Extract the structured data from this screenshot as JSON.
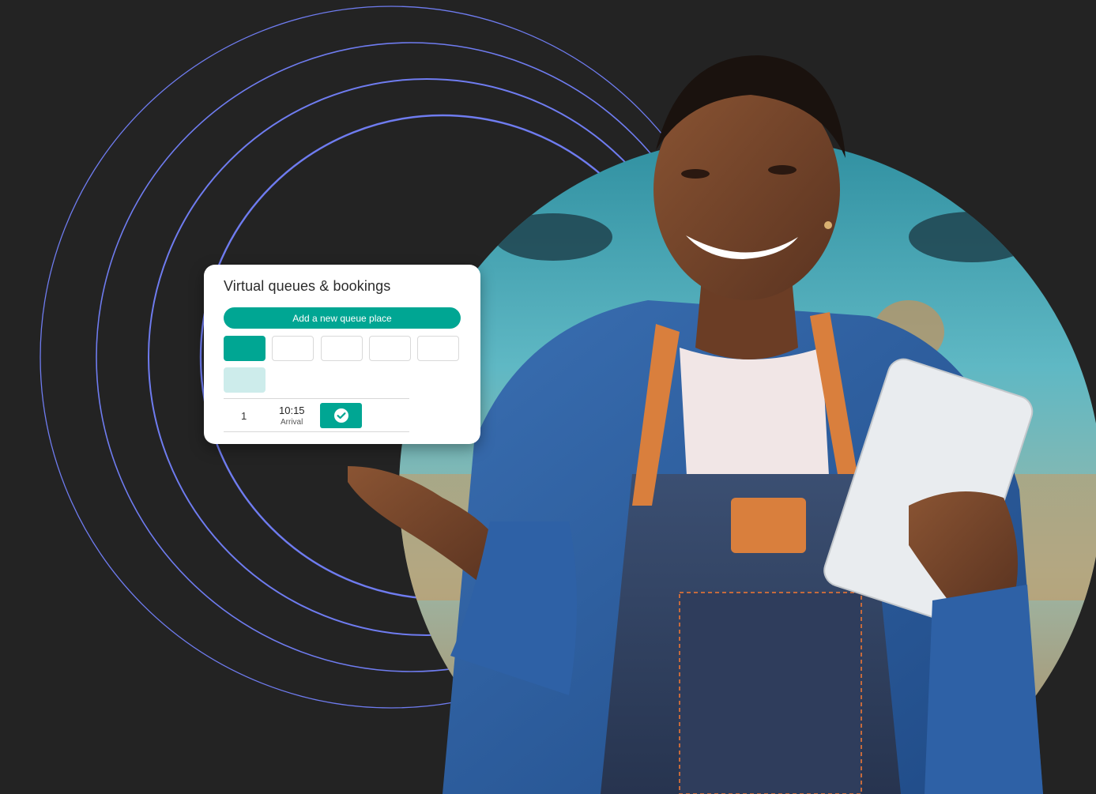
{
  "card": {
    "title": "Virtual queues & bookings",
    "add_button_label": "Add a new queue place",
    "slots": [
      {
        "state": "active"
      },
      {
        "state": "empty"
      },
      {
        "state": "empty"
      },
      {
        "state": "empty"
      },
      {
        "state": "empty"
      },
      {
        "state": "soft"
      }
    ],
    "entry": {
      "number": "1",
      "time": "10:15",
      "status": "Arrival",
      "confirm_icon": "check-circle-icon"
    }
  },
  "colors": {
    "background": "#232323",
    "accent": "#00a693",
    "accent_soft": "#cdeceb",
    "ring": "#6f7cf0"
  }
}
